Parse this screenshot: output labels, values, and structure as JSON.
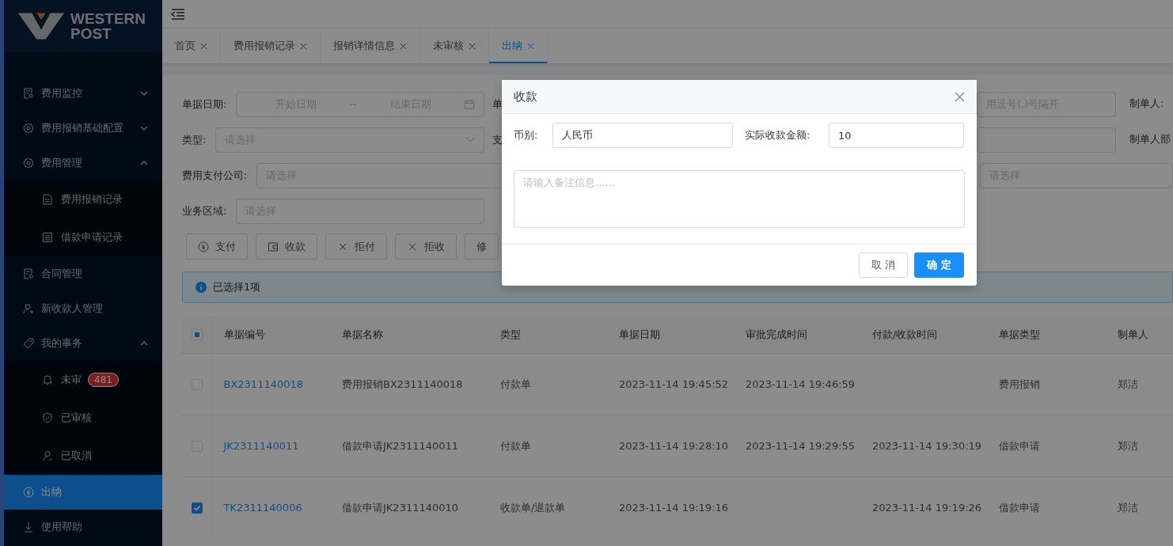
{
  "logo": {
    "line1": "WESTERN",
    "line2": "POST"
  },
  "sidebar": {
    "items": [
      {
        "label": "费用监控",
        "expanded": false,
        "selected": false
      },
      {
        "label": "费用报销基础配置",
        "expanded": false,
        "selected": false
      },
      {
        "label": "费用管理",
        "expanded": true,
        "selected": false,
        "children": [
          {
            "label": "费用报销记录",
            "selected": false
          },
          {
            "label": "借款申请记录",
            "selected": false
          }
        ]
      },
      {
        "label": "合同管理",
        "selected": false
      },
      {
        "label": "新收款人管理",
        "selected": false
      },
      {
        "label": "我的事务",
        "expanded": true,
        "selected": false,
        "children": [
          {
            "label": "未审",
            "badge": "481",
            "selected": false
          },
          {
            "label": "已审核",
            "selected": false
          },
          {
            "label": "已取消",
            "selected": false
          }
        ]
      },
      {
        "label": "出纳",
        "selected": true
      },
      {
        "label": "使用帮助",
        "selected": false
      }
    ]
  },
  "tabs": [
    {
      "label": "首页",
      "selected": false
    },
    {
      "label": "费用报销记录",
      "selected": false
    },
    {
      "label": "报销详情信息",
      "selected": false
    },
    {
      "label": "未审核",
      "selected": false
    },
    {
      "label": "出纳",
      "selected": true
    }
  ],
  "filters": [
    {
      "label": "单据日期:",
      "field": {
        "kind": "date-range",
        "start": "开始日期",
        "separator": "~",
        "end": "结束日期"
      },
      "middle_label": "单",
      "right_placeholder": "用逗号(,)号隔开",
      "right_label": "制单人:"
    },
    {
      "label": "类型:",
      "field": {
        "kind": "select",
        "placeholder": "请选择"
      },
      "middle_label": "支",
      "right_label": "制单人部"
    },
    {
      "label": "费用支付公司:",
      "field": {
        "kind": "input",
        "placeholder": "请选择"
      },
      "right_placeholder": "请选择"
    },
    {
      "label": "业务区域:",
      "field": {
        "kind": "input",
        "placeholder": "请选择"
      }
    }
  ],
  "actions": [
    {
      "label": "支付"
    },
    {
      "label": "收款"
    },
    {
      "label": "拒付"
    },
    {
      "label": "拒收"
    },
    {
      "label": "修"
    }
  ],
  "alert": {
    "text": "已选择1项"
  },
  "table": {
    "select_all": {
      "indeterminate": true
    },
    "columns": [
      "单据编号",
      "单据名称",
      "类型",
      "单据日期",
      "审批完成时间",
      "付款/收款时间",
      "单据类型",
      "制单人"
    ],
    "rows": [
      {
        "checked": false,
        "cells": [
          "BX2311140018",
          "费用报销BX2311140018",
          "付款单",
          "2023-11-14 19:45:52",
          "2023-11-14 19:46:59",
          "",
          "费用报销",
          "郑洁"
        ]
      },
      {
        "checked": false,
        "cells": [
          "JK2311140011",
          "借款申请JK2311140011",
          "付款单",
          "2023-11-14 19:28:10",
          "2023-11-14 19:29:55",
          "2023-11-14 19:30:19",
          "借款申请",
          "郑洁"
        ]
      },
      {
        "checked": true,
        "cells": [
          "TK2311140006",
          "借款申请JK2311140010",
          "收款单/退款单",
          "2023-11-14 19:19:16",
          "",
          "2023-11-14 19:19:26",
          "借款申请",
          "郑洁"
        ]
      }
    ]
  },
  "modal": {
    "title": "收款",
    "currency_label": "币别:",
    "currency_value": "人民币",
    "amount_label": "实际收款金额:",
    "amount_value": "10",
    "remark_placeholder": "请输入备注信息......",
    "cancel": "取 消",
    "ok": "确 定"
  }
}
